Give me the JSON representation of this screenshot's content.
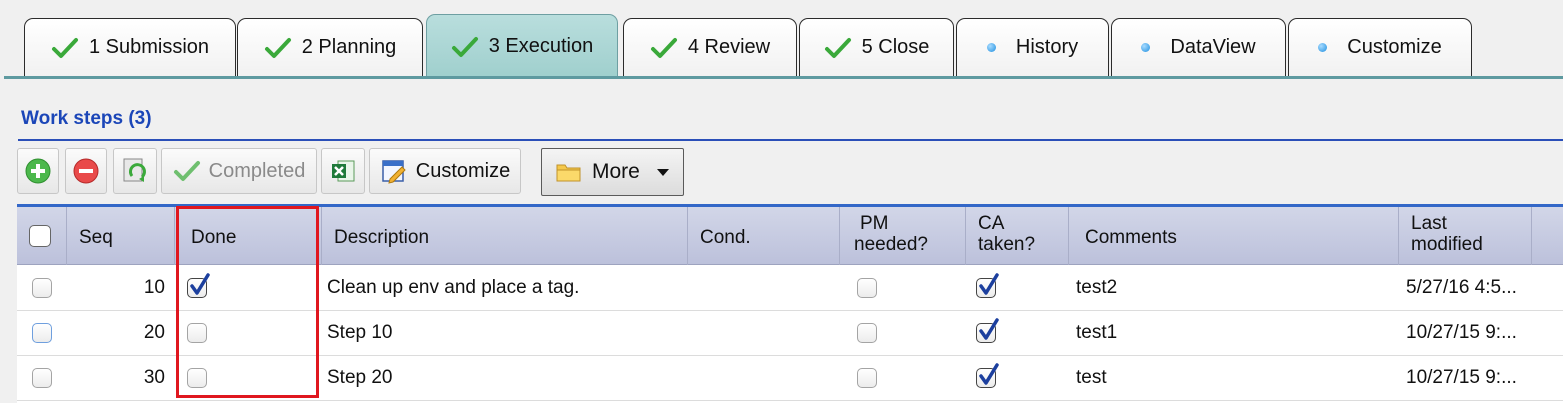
{
  "tabs": [
    {
      "label": "1 Submission",
      "icon": "check-icon"
    },
    {
      "label": "2 Planning",
      "icon": "check-icon"
    },
    {
      "label": "3 Execution",
      "icon": "check-icon",
      "active": true
    },
    {
      "label": "4 Review",
      "icon": "check-icon"
    },
    {
      "label": "5 Close",
      "icon": "check-icon"
    },
    {
      "label": "History",
      "icon": "dot-icon"
    },
    {
      "label": "DataView",
      "icon": "dot-icon"
    },
    {
      "label": "Customize",
      "icon": "dot-icon"
    }
  ],
  "section": {
    "title": "Work steps (3)"
  },
  "toolbar": {
    "completed_label": "Completed",
    "customize_label": "Customize",
    "more_label": "More"
  },
  "grid": {
    "headers": {
      "seq": "Seq",
      "done": "Done",
      "description": "Description",
      "cond": "Cond.",
      "pm_line1": "PM",
      "pm_line2": "needed?",
      "ca_line1": "CA",
      "ca_line2": "taken?",
      "comments": "Comments",
      "lm_line1": "Last",
      "lm_line2": "modified"
    },
    "rows": [
      {
        "seq": "10",
        "done": true,
        "description": "Clean up env and place a tag.",
        "cond": "",
        "pm_needed": false,
        "ca_taken": true,
        "comments": "test2",
        "last_modified": "5/27/16 4:5..."
      },
      {
        "seq": "20",
        "done": false,
        "description": "Step 10",
        "cond": "",
        "pm_needed": false,
        "ca_taken": true,
        "comments": "test1",
        "last_modified": "10/27/15 9:..."
      },
      {
        "seq": "30",
        "done": false,
        "description": "Step 20",
        "cond": "",
        "pm_needed": false,
        "ca_taken": true,
        "comments": "test",
        "last_modified": "10/27/15 9:..."
      }
    ]
  },
  "colors": {
    "active_tab": "#a6d3d1",
    "title_blue": "#1b46b8",
    "highlight_red": "#e0171f",
    "check_green": "#3aa93a",
    "check_blue": "#1c3f9e"
  }
}
